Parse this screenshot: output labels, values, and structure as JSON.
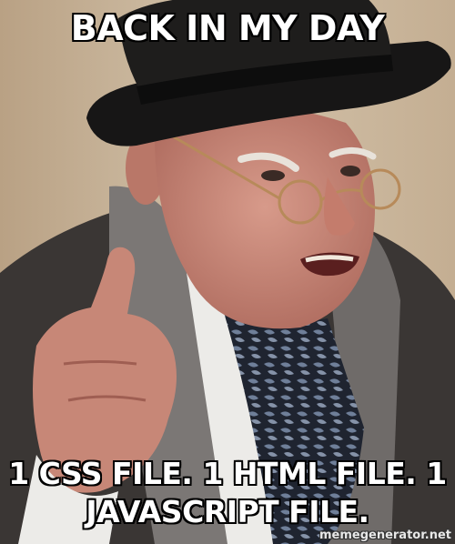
{
  "meme": {
    "top_text": "BACK IN MY DAY",
    "bottom_text": "1 CSS FILE. 1 HTML FILE. 1 JAVASCRIPT FILE.",
    "watermark": "memegenerator.net"
  },
  "colors": {
    "background_wall": "#cbb79d",
    "hat": "#171616",
    "skin": "#c9877a",
    "coat": "#3a3634",
    "scarf": "#7b7775",
    "shirt": "#ecebe8",
    "caption_fill": "#ffffff",
    "caption_outline": "#000000"
  }
}
